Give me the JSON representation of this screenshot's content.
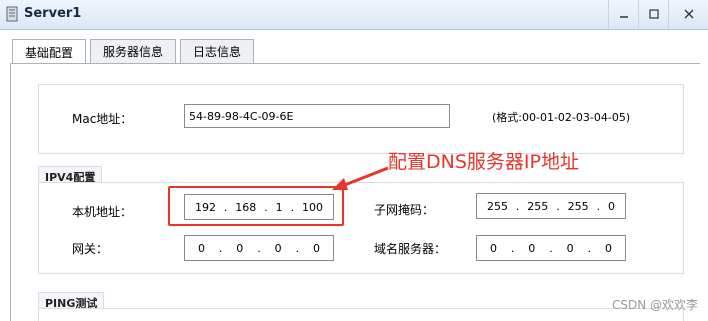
{
  "window": {
    "title": "Server1"
  },
  "tabs": [
    "基础配置",
    "服务器信息",
    "日志信息"
  ],
  "mac": {
    "label": "Mac地址：",
    "value": "54-89-98-4C-09-6E",
    "format_hint": "(格式:00-01-02-03-04-05)"
  },
  "ipv4": {
    "section_title": "IPV4配置",
    "host_ip": {
      "label": "本机地址：",
      "octets": [
        "192",
        "168",
        "1",
        "100"
      ]
    },
    "subnet_mask": {
      "label": "子网掩码：",
      "octets": [
        "255",
        "255",
        "255",
        "0"
      ]
    },
    "gateway": {
      "label": "网关：",
      "octets": [
        "0",
        "0",
        "0",
        "0"
      ]
    },
    "dns": {
      "label": "域名服务器：",
      "octets": [
        "0",
        "0",
        "0",
        "0"
      ]
    }
  },
  "ping": {
    "section_title": "PING测试"
  },
  "annotation": {
    "text": "配置DNS服务器IP地址",
    "color": "#e8352a"
  },
  "watermark": "CSDN @欢欢李"
}
